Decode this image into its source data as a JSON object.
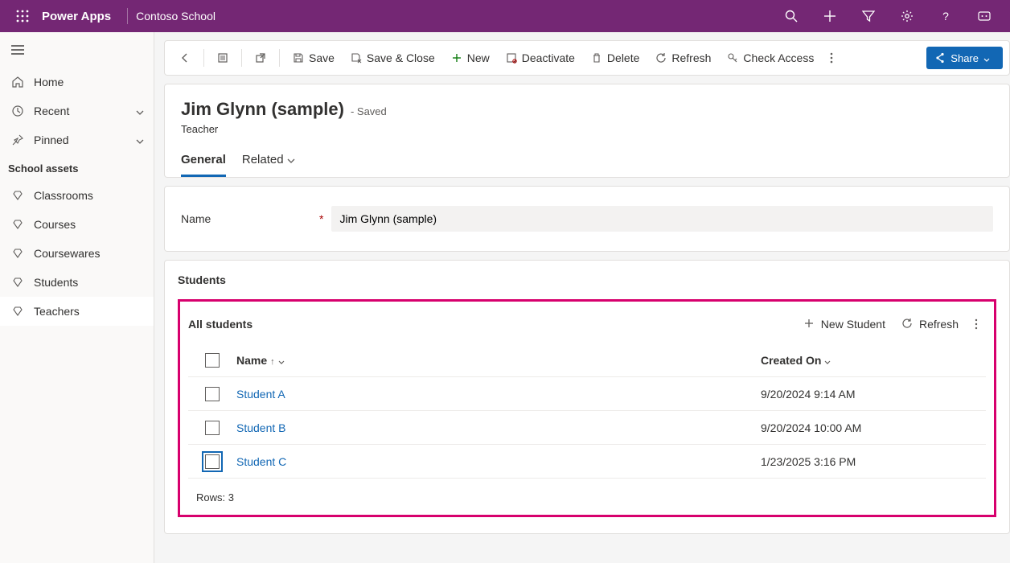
{
  "header": {
    "product": "Power Apps",
    "app": "Contoso School"
  },
  "nav": {
    "home": "Home",
    "recent": "Recent",
    "pinned": "Pinned",
    "group": "School assets",
    "items": [
      "Classrooms",
      "Courses",
      "Coursewares",
      "Students",
      "Teachers"
    ]
  },
  "cmd": {
    "save": "Save",
    "saveclose": "Save & Close",
    "new": "New",
    "deactivate": "Deactivate",
    "delete": "Delete",
    "refresh": "Refresh",
    "checkaccess": "Check Access",
    "share": "Share"
  },
  "record": {
    "title": "Jim Glynn (sample)",
    "saved": "- Saved",
    "entity": "Teacher",
    "tabs": [
      "General",
      "Related"
    ]
  },
  "form": {
    "name_label": "Name",
    "name_value": "Jim Glynn (sample)"
  },
  "subgrid": {
    "section_title": "Students",
    "view_name": "All students",
    "new_btn": "New Student",
    "refresh_btn": "Refresh",
    "columns": [
      "Name",
      "Created On"
    ],
    "rows": [
      {
        "name": "Student A",
        "created": "9/20/2024 9:14 AM"
      },
      {
        "name": "Student B",
        "created": "9/20/2024 10:00 AM"
      },
      {
        "name": "Student C",
        "created": "1/23/2025 3:16 PM"
      }
    ],
    "rowcount": "Rows: 3"
  }
}
